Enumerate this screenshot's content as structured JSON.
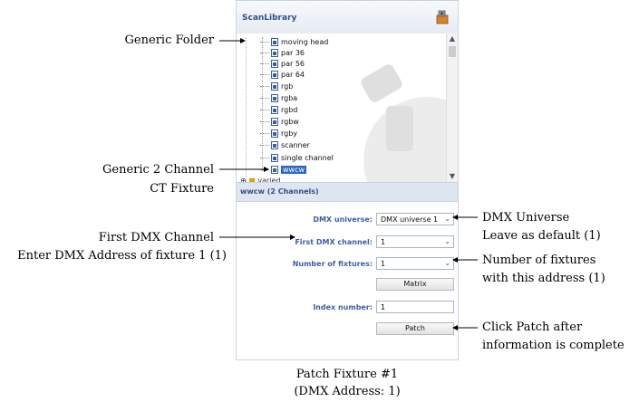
{
  "panel": {
    "title": "ScanLibrary",
    "tree_items": [
      "moving head",
      "par 36",
      "par 56",
      "par 64",
      "rgb",
      "rgba",
      "rgbd",
      "rgbw",
      "rgby",
      "scanner",
      "single channel",
      "wwcw"
    ],
    "selected_item": "wwcw",
    "partial_item": "varied",
    "status": "wwcw (2 Channels)",
    "form": {
      "dmx_universe_label": "DMX universe:",
      "dmx_universe_value": "DMX universe 1",
      "first_channel_label": "First DMX channel:",
      "first_channel_value": "1",
      "fixtures_label": "Number of fixtures:",
      "fixtures_value": "1",
      "matrix_label": "Matrix",
      "index_label": "Index number:",
      "index_value": "1",
      "patch_label": "Patch"
    }
  },
  "annotations": {
    "generic_folder": "Generic Folder",
    "generic_2ch_line1": "Generic 2 Channel",
    "generic_2ch_line2": "CT Fixture",
    "first_dmx_line1": "First DMX Channel",
    "first_dmx_line2": "Enter DMX Address of fixture 1 (1)",
    "dmx_universe_line1": "DMX Universe",
    "dmx_universe_line2": "Leave as default (1)",
    "fixtures_line1": "Number of fixtures",
    "fixtures_line2": "with this address (1)",
    "patch_line1": "Click Patch after",
    "patch_line2": "information is complete",
    "caption_line1": "Patch Fixture #1",
    "caption_line2": "(DMX Address: 1)"
  }
}
